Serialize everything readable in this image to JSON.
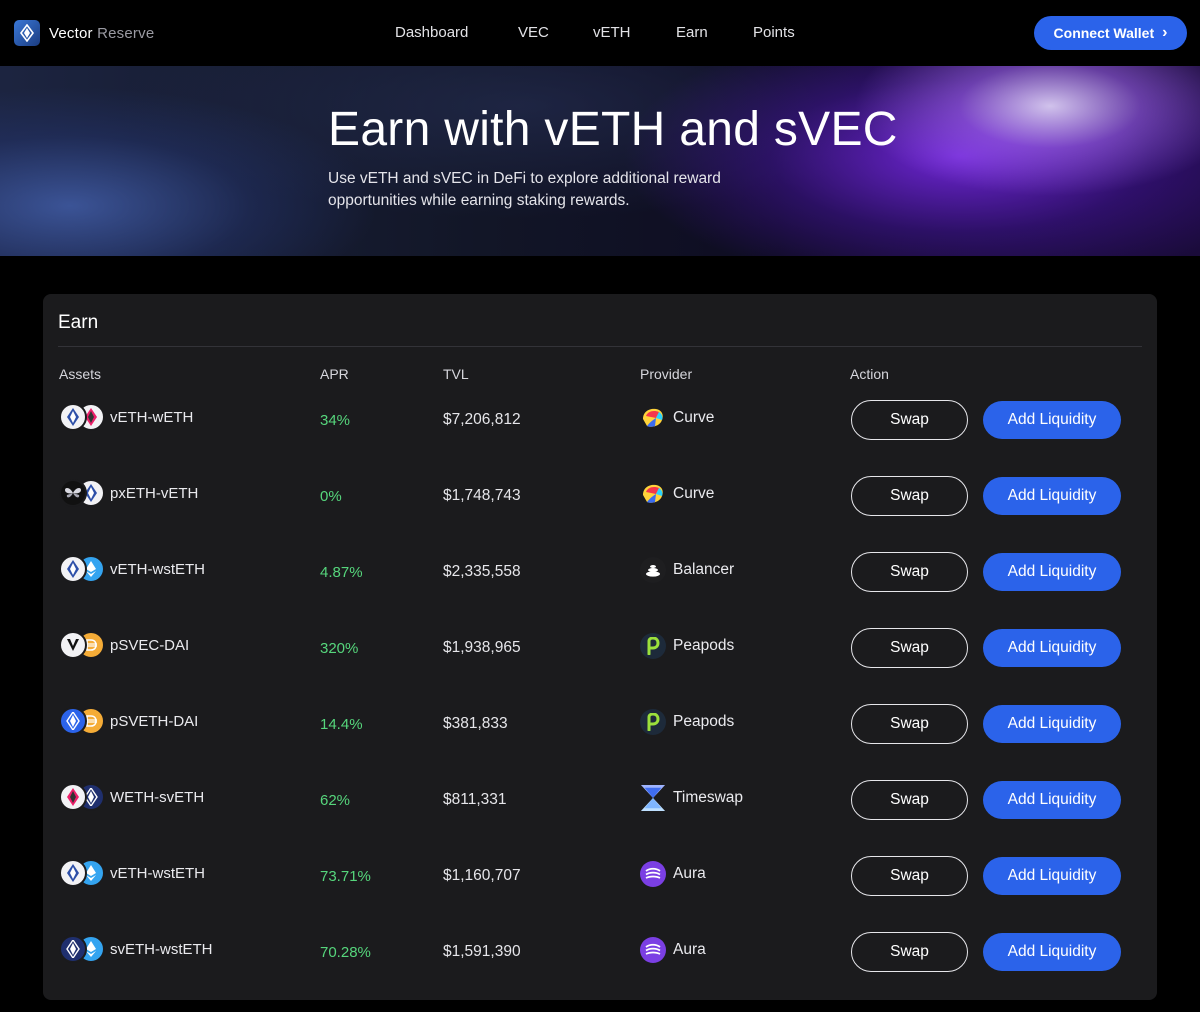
{
  "nav": {
    "logo_primary": "Vector",
    "logo_secondary": "Reserve",
    "links": [
      "Dashboard",
      "VEC",
      "vETH",
      "Earn",
      "Points"
    ],
    "connect_label": "Connect Wallet",
    "connect_chevron": "›",
    "accent_color": "#2b63ea"
  },
  "hero": {
    "title": "Earn with vETH and sVEC",
    "subtitle": "Use vETH and sVEC in DeFi to explore additional reward opportunities while earning staking rewards."
  },
  "earn": {
    "title": "Earn",
    "columns": [
      "Assets",
      "APR",
      "TVL",
      "Provider",
      "Action"
    ],
    "swap_label": "Swap",
    "add_liquidity_label": "Add Liquidity",
    "apr_color": "#56d67c",
    "rows": [
      {
        "asset": "vETH-wETH",
        "apr": "34%",
        "tvl": "$7,206,812",
        "provider": "Curve",
        "icons": [
          "veth-icon",
          "weth-icon"
        ],
        "provider_icon": "curve-icon"
      },
      {
        "asset": "pxETH-vETH",
        "apr": "0%",
        "tvl": "$1,748,743",
        "provider": "Curve",
        "icons": [
          "pxeth-icon",
          "veth-icon"
        ],
        "provider_icon": "curve-icon"
      },
      {
        "asset": "vETH-wstETH",
        "apr": "4.87%",
        "tvl": "$2,335,558",
        "provider": "Balancer",
        "icons": [
          "veth-icon",
          "wsteth-icon"
        ],
        "provider_icon": "balancer-icon"
      },
      {
        "asset": "pSVEC-DAI",
        "apr": "320%",
        "tvl": "$1,938,965",
        "provider": "Peapods",
        "icons": [
          "vec-icon",
          "dai-icon"
        ],
        "provider_icon": "peapods-icon"
      },
      {
        "asset": "pSVETH-DAI",
        "apr": "14.4%",
        "tvl": "$381,833",
        "provider": "Peapods",
        "icons": [
          "sveth-icon",
          "dai-icon"
        ],
        "provider_icon": "peapods-icon"
      },
      {
        "asset": "WETH-svETH",
        "apr": "62%",
        "tvl": "$811,331",
        "provider": "Timeswap",
        "icons": [
          "weth-icon",
          "sveth-icon"
        ],
        "provider_icon": "timeswap-icon"
      },
      {
        "asset": "vETH-wstETH",
        "apr": "73.71%",
        "tvl": "$1,160,707",
        "provider": "Aura",
        "icons": [
          "veth-icon",
          "wsteth-icon"
        ],
        "provider_icon": "aura-icon"
      },
      {
        "asset": "svETH-wstETH",
        "apr": "70.28%",
        "tvl": "$1,591,390",
        "provider": "Aura",
        "icons": [
          "sveth-icon",
          "wsteth-icon"
        ],
        "provider_icon": "aura-icon"
      }
    ]
  }
}
